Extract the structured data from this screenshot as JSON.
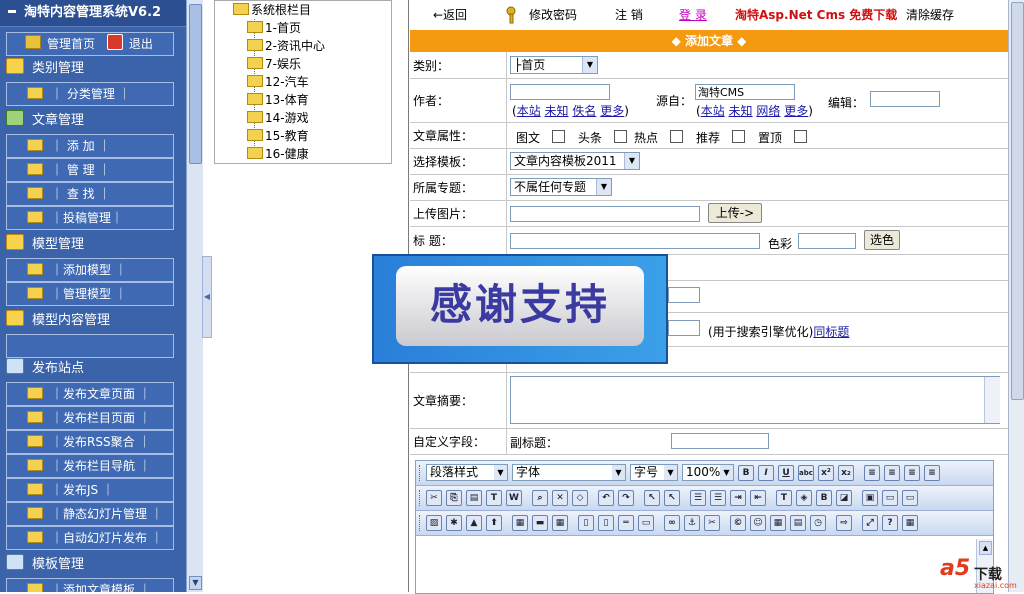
{
  "sidebar": {
    "title": "淘特内容管理系统V6.2",
    "home_label": "管理首页",
    "logout_label": "退出",
    "sections": [
      {
        "label": "类别管理"
      },
      {
        "label": "文章管理"
      },
      {
        "label": "模型管理"
      },
      {
        "label": "模型内容管理"
      },
      {
        "label": "发布站点"
      },
      {
        "label": "模板管理"
      }
    ],
    "items": {
      "category": [
        "｜ 分类管理 ｜"
      ],
      "article": [
        "｜ 添 加 ｜",
        "｜ 管 理 ｜",
        "｜ 查 找 ｜",
        "｜投稿管理｜"
      ],
      "model": [
        "｜添加模型 ｜",
        "｜管理模型 ｜"
      ],
      "publish": [
        "｜发布文章页面 ｜",
        "｜发布栏目页面 ｜",
        "｜发布RSS聚合 ｜",
        "｜发布栏目导航 ｜",
        "｜发布JS ｜",
        "｜静态幻灯片管理 ｜",
        "｜自动幻灯片发布 ｜"
      ],
      "template": [
        "｜添加文章模板 ｜"
      ]
    }
  },
  "tree": {
    "root": "系统根栏目",
    "nodes": [
      "1-首页",
      "2-资讯中心",
      "7-娱乐",
      "12-汽车",
      "13-体育",
      "14-游戏",
      "15-教育",
      "16-健康"
    ]
  },
  "topbar": {
    "back": "←返回",
    "change_password": "修改密码",
    "logout": "注 销",
    "login": "登 录",
    "promo": "淘特Asp.Net Cms 免费下载",
    "clear_cache": "清除缓存"
  },
  "form": {
    "header": "◆ 添加文章 ◆",
    "category_label": "类别：",
    "category_value": "├首页",
    "author_label": "作者：",
    "author_links": [
      "本站",
      "未知",
      "佚名",
      "更多"
    ],
    "source_label": "源自：",
    "source_value": "淘特CMS",
    "source_links": [
      "本站",
      "未知",
      "网络",
      "更多"
    ],
    "editor_label": "编辑：",
    "attr_label": "文章属性：",
    "attrs": [
      "图文",
      "头条",
      "热点",
      "推荐",
      "置顶"
    ],
    "template_label": "选择模板：",
    "template_value": "文章内容模板2011",
    "topic_label": "所属专题：",
    "topic_value": "不属任何专题",
    "upload_label": "上传图片：",
    "upload_button": "上传->",
    "title_label": "标 题：",
    "color_label": "色彩",
    "pick_color": "选色",
    "seo_hint": "(用于搜索引擎优化)",
    "same_title": "同标题",
    "summary_label": "文章摘要：",
    "custom_label": "自定义字段：",
    "subtitle_label": "副标题："
  },
  "editor": {
    "paragraph": "段落样式",
    "font": "字体",
    "size": "字号",
    "zoom": "100%"
  },
  "banner": {
    "text": "感谢支持"
  },
  "watermark": {
    "brand": "a5",
    "text": "下载",
    "domain": "xiazai.com"
  }
}
